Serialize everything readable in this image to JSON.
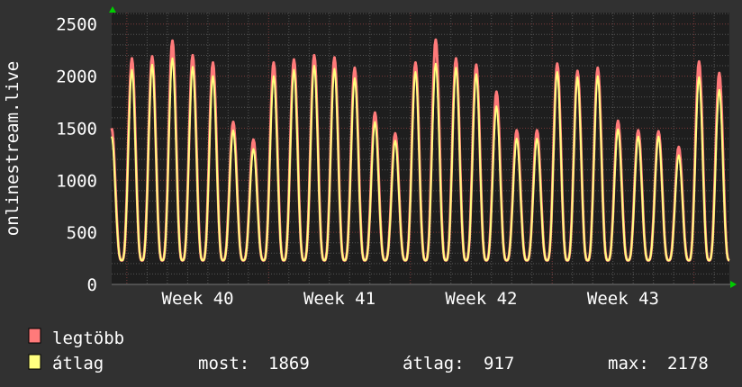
{
  "chart_data": {
    "type": "line",
    "ylabel": "onlinestream.live",
    "ylim": [
      0,
      2610
    ],
    "yticks": [
      "0",
      "500",
      "1000",
      "1500",
      "2000",
      "2500"
    ],
    "ytick_values": [
      0,
      500,
      1000,
      1500,
      2000,
      2500
    ],
    "xticks": [
      "Week 40",
      "Week 41",
      "Week 42",
      "Week 43"
    ],
    "x_unit": "day",
    "xlim_days": [
      0,
      30.5
    ],
    "week_label_days": [
      4.25,
      11.25,
      18.25,
      25.25
    ],
    "week_boundary_days": [
      0.75,
      7.75,
      14.75,
      21.75,
      28.75
    ],
    "grid": true,
    "trough": 230,
    "series": [
      {
        "name": "legtöbb",
        "color": "#ff7a7a",
        "daily_peaks": [
          1500,
          2170,
          2190,
          2340,
          2200,
          2130,
          1560,
          1390,
          2130,
          2160,
          2200,
          2180,
          2080,
          1650,
          1450,
          2130,
          2350,
          2170,
          2110,
          1850,
          1480,
          1480,
          2120,
          2050,
          2080,
          1570,
          1480,
          1470,
          1320,
          2140,
          2030
        ]
      },
      {
        "name": "átlag",
        "color": "#ffff80",
        "daily_peaks": [
          1420,
          2060,
          2110,
          2170,
          2090,
          2000,
          1480,
          1300,
          2000,
          2060,
          2100,
          2070,
          1980,
          1560,
          1380,
          2040,
          2120,
          2080,
          2020,
          1710,
          1400,
          1400,
          2040,
          1990,
          2000,
          1490,
          1420,
          1420,
          1240,
          1990,
          1869
        ]
      }
    ],
    "legend": {
      "placement": "bottom-left",
      "entries": [
        "legtöbb",
        "átlag"
      ],
      "stats": {
        "most_label": "most:",
        "most": "1869",
        "atlag_label": "átlag:",
        "atlag": "917",
        "max_label": "max:",
        "max": "2178"
      }
    }
  }
}
